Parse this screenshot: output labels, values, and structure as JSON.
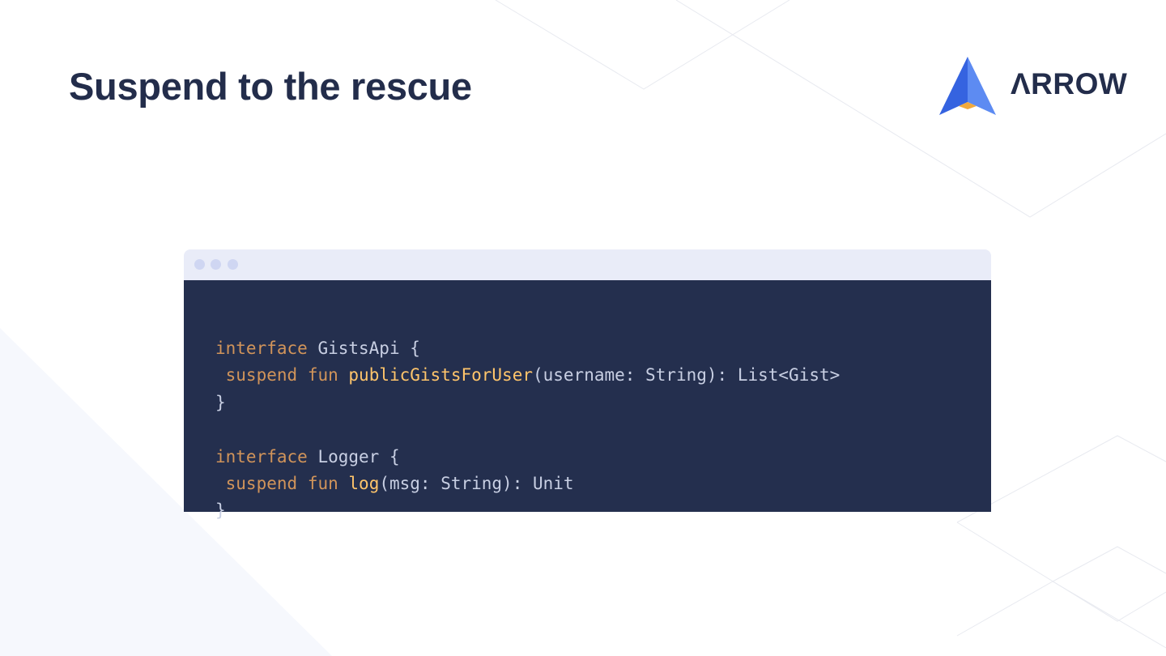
{
  "slide": {
    "title": "Suspend to the rescue"
  },
  "logo": {
    "text": "ΛRROW",
    "icon": "arrow-logo-icon",
    "colors": {
      "blue": "#3563e0",
      "light_blue": "#5d8bf2",
      "orange": "#f2a93b",
      "text": "#232d4b"
    }
  },
  "code_window": {
    "title_bar_dots": [
      "dot",
      "dot",
      "dot"
    ],
    "lines": [
      [
        {
          "t": "interface",
          "c": "kw"
        },
        {
          "t": " GistsApi {",
          "c": "tx"
        }
      ],
      [
        {
          "t": " suspend",
          "c": "kw"
        },
        {
          "t": " ",
          "c": "tx"
        },
        {
          "t": "fun",
          "c": "kw"
        },
        {
          "t": " ",
          "c": "tx"
        },
        {
          "t": "publicGistsForUser",
          "c": "fn"
        },
        {
          "t": "(username: String): List<Gist>",
          "c": "tx"
        }
      ],
      [
        {
          "t": "}",
          "c": "tx"
        }
      ],
      [],
      [
        {
          "t": "interface",
          "c": "kw"
        },
        {
          "t": " Logger {",
          "c": "tx"
        }
      ],
      [
        {
          "t": " suspend",
          "c": "kw"
        },
        {
          "t": " ",
          "c": "tx"
        },
        {
          "t": "fun",
          "c": "kw"
        },
        {
          "t": " ",
          "c": "tx"
        },
        {
          "t": "log",
          "c": "fn"
        },
        {
          "t": "(msg: String): Unit",
          "c": "tx"
        }
      ],
      [
        {
          "t": "}",
          "c": "tx"
        }
      ]
    ],
    "colors": {
      "background": "#242f4e",
      "bar": "#e9ecf8",
      "keyword": "#d1945a",
      "function": "#ffc56b",
      "text": "#c8cfe3"
    }
  }
}
